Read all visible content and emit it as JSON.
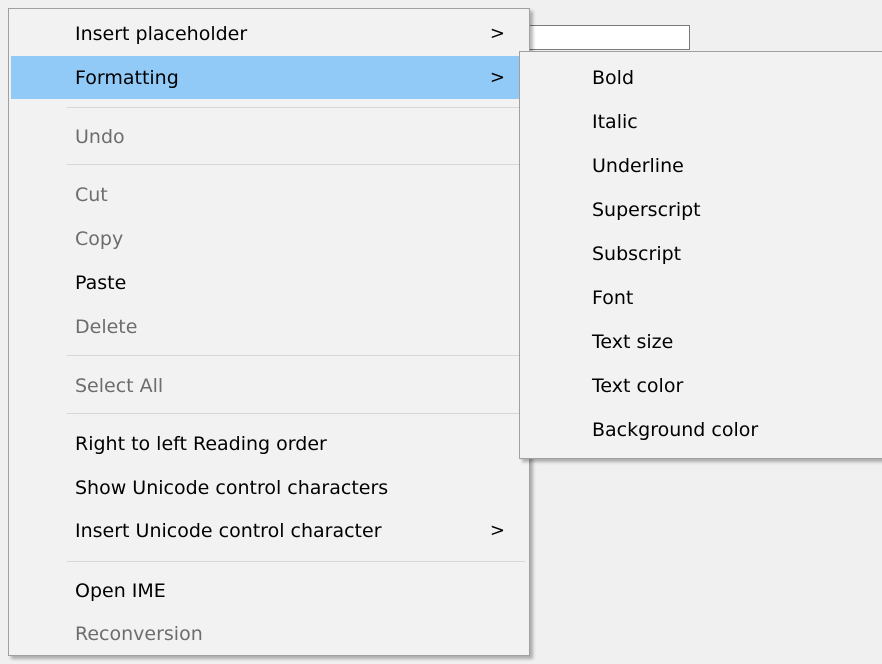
{
  "context_menu": {
    "items": [
      {
        "label": "Insert placeholder",
        "arrow": ">"
      },
      {
        "label": "Formatting",
        "arrow": ">"
      },
      {
        "label": "Undo"
      },
      {
        "label": "Cut"
      },
      {
        "label": "Copy"
      },
      {
        "label": "Paste"
      },
      {
        "label": "Delete"
      },
      {
        "label": "Select All"
      },
      {
        "label": "Right to left Reading order"
      },
      {
        "label": "Show Unicode control characters"
      },
      {
        "label": "Insert Unicode control character",
        "arrow": ">"
      },
      {
        "label": "Open IME"
      },
      {
        "label": "Reconversion"
      }
    ]
  },
  "formatting_submenu": {
    "items": [
      {
        "label": "Bold"
      },
      {
        "label": "Italic"
      },
      {
        "label": "Underline"
      },
      {
        "label": "Superscript"
      },
      {
        "label": "Subscript"
      },
      {
        "label": "Font"
      },
      {
        "label": "Text size"
      },
      {
        "label": "Text color"
      },
      {
        "label": "Background color"
      }
    ]
  },
  "colors": {
    "highlight": "#91c9f7",
    "menu_background": "#f2f2f2",
    "disabled_text": "#6d6d6d"
  }
}
